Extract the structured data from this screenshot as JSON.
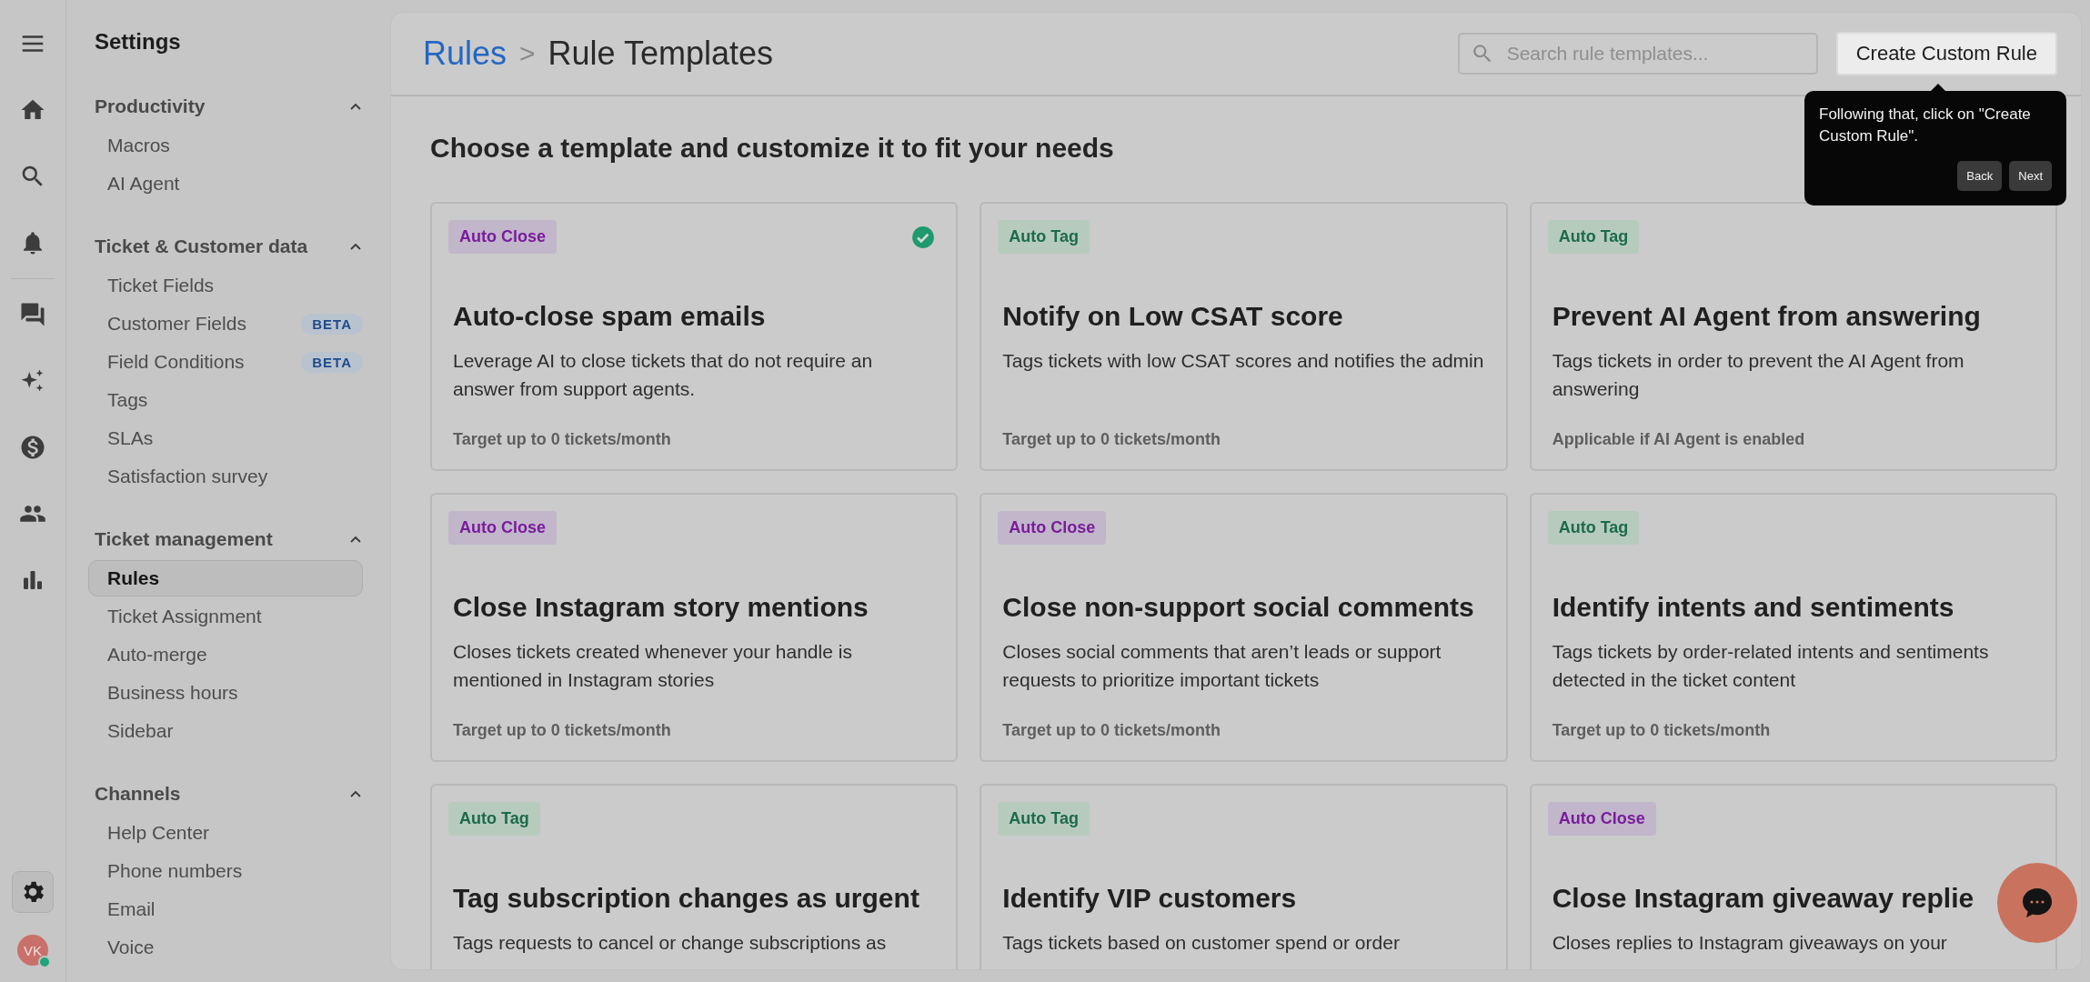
{
  "rail": {
    "items": [
      {
        "kind": "menu",
        "selected": false
      },
      {
        "kind": "home",
        "selected": false
      },
      {
        "kind": "search",
        "selected": false
      },
      {
        "kind": "bell",
        "selected": false
      },
      {
        "kind": "chat",
        "selected": false
      },
      {
        "kind": "sparkle",
        "selected": false
      },
      {
        "kind": "dollar",
        "selected": false
      },
      {
        "kind": "people",
        "selected": false
      },
      {
        "kind": "chart",
        "selected": false
      },
      {
        "kind": "gear",
        "selected": true
      }
    ],
    "avatar": {
      "initials": "VK",
      "online": true
    }
  },
  "sidebar": {
    "title": "Settings",
    "sections": [
      {
        "title": "Productivity",
        "expanded": true,
        "items": [
          {
            "label": "Macros",
            "selected": false
          },
          {
            "label": "AI Agent",
            "selected": false
          }
        ]
      },
      {
        "title": "Ticket & Customer data",
        "expanded": true,
        "items": [
          {
            "label": "Ticket Fields",
            "selected": false
          },
          {
            "label": "Customer Fields",
            "selected": false,
            "badge": "BETA"
          },
          {
            "label": "Field Conditions",
            "selected": false,
            "badge": "BETA"
          },
          {
            "label": "Tags",
            "selected": false
          },
          {
            "label": "SLAs",
            "selected": false
          },
          {
            "label": "Satisfaction survey",
            "selected": false
          }
        ]
      },
      {
        "title": "Ticket management",
        "expanded": true,
        "items": [
          {
            "label": "Rules",
            "selected": true
          },
          {
            "label": "Ticket Assignment",
            "selected": false
          },
          {
            "label": "Auto-merge",
            "selected": false
          },
          {
            "label": "Business hours",
            "selected": false
          },
          {
            "label": "Sidebar",
            "selected": false
          }
        ]
      },
      {
        "title": "Channels",
        "expanded": true,
        "items": [
          {
            "label": "Help Center",
            "selected": false
          },
          {
            "label": "Phone numbers",
            "selected": false
          },
          {
            "label": "Email",
            "selected": false
          },
          {
            "label": "Voice",
            "selected": false
          }
        ]
      }
    ]
  },
  "header": {
    "breadcrumb": [
      {
        "label": "Rules",
        "kind": "link"
      },
      {
        "label": "Rule Templates",
        "kind": "current"
      }
    ],
    "separator": ">",
    "search": {
      "placeholder": "Search rule templates..."
    },
    "button": "Create Custom Rule"
  },
  "tooltip": {
    "text": "Following that, click on \"Create Custom Rule\".",
    "buttons": [
      "Back",
      "Next"
    ]
  },
  "heading": "Choose a template and customize it to fit your needs",
  "cards": [
    {
      "tag": {
        "label": "Auto Close",
        "kind": "close"
      },
      "selected": true,
      "title": "Auto-close spam emails",
      "description": "Leverage AI to close tickets that do not require an answer from support agents.",
      "footer": "Target up to 0 tickets/month"
    },
    {
      "tag": {
        "label": "Auto Tag",
        "kind": "tag"
      },
      "selected": false,
      "title": "Notify on Low CSAT score",
      "description": "Tags tickets with low CSAT scores and notifies the admin",
      "footer": "Target up to 0 tickets/month"
    },
    {
      "tag": {
        "label": "Auto Tag",
        "kind": "tag"
      },
      "selected": false,
      "title": "Prevent AI Agent from answering",
      "description": "Tags tickets in order to prevent the AI Agent from answering",
      "footer": "Applicable if AI Agent is enabled"
    },
    {
      "tag": {
        "label": "Auto Close",
        "kind": "close"
      },
      "selected": false,
      "title": "Close Instagram story mentions",
      "description": "Closes tickets created whenever your handle is mentioned in Instagram stories",
      "footer": "Target up to 0 tickets/month"
    },
    {
      "tag": {
        "label": "Auto Close",
        "kind": "close"
      },
      "selected": false,
      "title": "Close non-support social comments",
      "description": "Closes social comments that aren’t leads or support requests to prioritize important tickets",
      "footer": "Target up to 0 tickets/month"
    },
    {
      "tag": {
        "label": "Auto Tag",
        "kind": "tag"
      },
      "selected": false,
      "title": "Identify intents and sentiments",
      "description": "Tags tickets by order-related intents and sentiments detected in the ticket content",
      "footer": "Target up to 0 tickets/month"
    },
    {
      "tag": {
        "label": "Auto Tag",
        "kind": "tag"
      },
      "selected": false,
      "title": "Tag subscription changes as urgent",
      "description": "Tags requests to cancel or change subscriptions as"
    },
    {
      "tag": {
        "label": "Auto Tag",
        "kind": "tag"
      },
      "selected": false,
      "title": "Identify VIP customers",
      "description": "Tags tickets based on customer spend or order"
    },
    {
      "tag": {
        "label": "Auto Close",
        "kind": "close"
      },
      "selected": false,
      "title": "Close Instagram giveaway replie",
      "description": "Closes replies to Instagram giveaways on your"
    }
  ]
}
